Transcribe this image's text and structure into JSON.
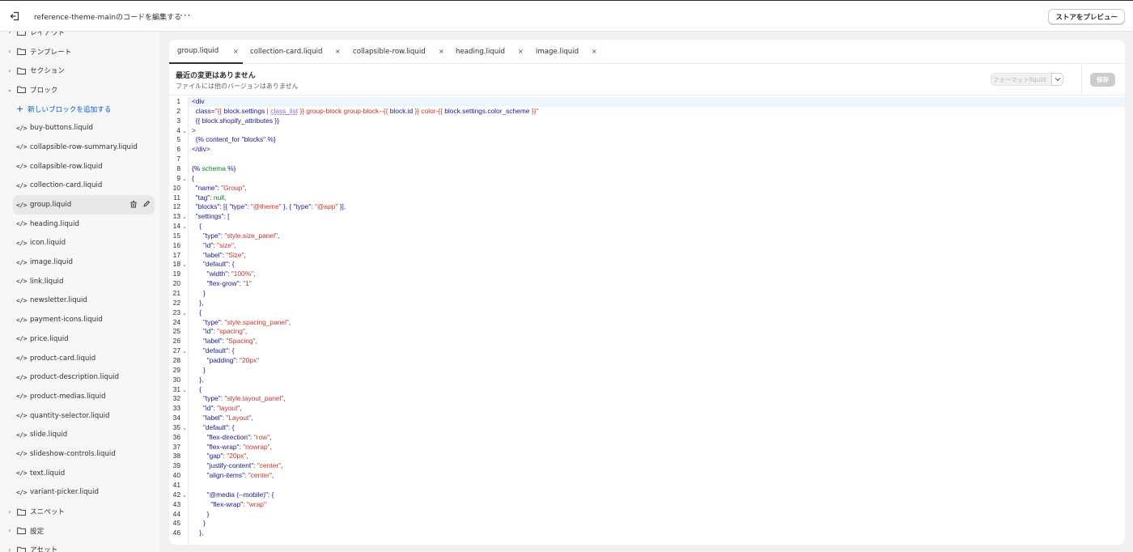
{
  "header": {
    "title": "reference-theme-mainのコードを編集する",
    "more": "···",
    "preview": "ストアをプレビュー"
  },
  "sidebar": {
    "folders_top": [
      {
        "label": "レイアウト"
      },
      {
        "label": "テンプレート"
      },
      {
        "label": "セクション"
      },
      {
        "label": "ブロック"
      }
    ],
    "add_block": "新しいブロックを追加する",
    "files": [
      "buy-buttons.liquid",
      "collapsible-row-summary.liquid",
      "collapsible-row.liquid",
      "collection-card.liquid",
      "group.liquid",
      "heading.liquid",
      "icon.liquid",
      "image.liquid",
      "link.liquid",
      "newsletter.liquid",
      "payment-icons.liquid",
      "price.liquid",
      "product-card.liquid",
      "product-description.liquid",
      "product-medias.liquid",
      "quantity-selector.liquid",
      "slide.liquid",
      "slideshow-controls.liquid",
      "text.liquid",
      "variant-picker.liquid"
    ],
    "active_file": "group.liquid",
    "folders_bottom": [
      {
        "label": "スニペット"
      },
      {
        "label": "設定"
      },
      {
        "label": "アセット"
      }
    ]
  },
  "tabs": [
    {
      "label": "group.liquid",
      "active": true
    },
    {
      "label": "collection-card.liquid"
    },
    {
      "label": "collapsible-row.liquid"
    },
    {
      "label": "heading.liquid"
    },
    {
      "label": "image.liquid"
    }
  ],
  "status": {
    "title": "最近の変更はありません",
    "subtitle": "ファイルには他のバージョンはありません",
    "format_button": "フォーマットliquid",
    "save_button": "保存"
  },
  "code": [
    {
      "n": "1",
      "fold": false,
      "parts": [
        [
          "t",
          "<div"
        ]
      ]
    },
    {
      "n": "2",
      "fold": false,
      "parts": [
        [
          "t",
          "  class="
        ],
        [
          "s",
          "\"{{ "
        ],
        [
          "k",
          "block.settings"
        ],
        [
          "s",
          " | "
        ],
        [
          "u",
          "class_list"
        ],
        [
          "s",
          " }} group-block group-block--{{ "
        ],
        [
          "k",
          "block.id"
        ],
        [
          "s",
          " }} color-{{ "
        ],
        [
          "k",
          "block.settings.color_scheme"
        ],
        [
          "s",
          " }}\""
        ]
      ]
    },
    {
      "n": "3",
      "fold": false,
      "parts": [
        [
          "k",
          "  {{ block.shopify_attributes }}"
        ]
      ]
    },
    {
      "n": "4",
      "fold": true,
      "parts": [
        [
          "t",
          ">"
        ]
      ]
    },
    {
      "n": "5",
      "fold": false,
      "parts": [
        [
          "k",
          "  {% content_for "
        ],
        [
          "t",
          "\"blocks\""
        ],
        [
          "k",
          " %}"
        ]
      ]
    },
    {
      "n": "6",
      "fold": false,
      "parts": [
        [
          "t",
          "</div>"
        ]
      ]
    },
    {
      "n": "7",
      "fold": false,
      "parts": []
    },
    {
      "n": "8",
      "fold": false,
      "parts": [
        [
          "k",
          "{% "
        ],
        [
          "g",
          "schema"
        ],
        [
          "k",
          " %}"
        ]
      ]
    },
    {
      "n": "9",
      "fold": true,
      "parts": [
        [
          "t",
          "{"
        ]
      ]
    },
    {
      "n": "10",
      "fold": false,
      "parts": [
        [
          "t",
          "  \"name\": "
        ],
        [
          "s",
          "\"Group\""
        ],
        [
          "t",
          ","
        ]
      ]
    },
    {
      "n": "11",
      "fold": false,
      "parts": [
        [
          "t",
          "  \"tag\": "
        ],
        [
          "g",
          "null"
        ],
        [
          "t",
          ","
        ]
      ]
    },
    {
      "n": "12",
      "fold": false,
      "parts": [
        [
          "t",
          "  \"blocks\": [{ \"type\": "
        ],
        [
          "s",
          "\"@theme\""
        ],
        [
          "t",
          " }, { \"type\": "
        ],
        [
          "s",
          "\"@app\""
        ],
        [
          "t",
          " }],"
        ]
      ]
    },
    {
      "n": "13",
      "fold": true,
      "parts": [
        [
          "t",
          "  \"settings\": ["
        ]
      ]
    },
    {
      "n": "14",
      "fold": true,
      "parts": [
        [
          "t",
          "    {"
        ]
      ]
    },
    {
      "n": "15",
      "fold": false,
      "parts": [
        [
          "t",
          "      \"type\": "
        ],
        [
          "s",
          "\"style.size_panel\""
        ],
        [
          "t",
          ","
        ]
      ]
    },
    {
      "n": "16",
      "fold": false,
      "parts": [
        [
          "t",
          "      \"id\": "
        ],
        [
          "s",
          "\"size\""
        ],
        [
          "t",
          ","
        ]
      ]
    },
    {
      "n": "17",
      "fold": false,
      "parts": [
        [
          "t",
          "      \"label\": "
        ],
        [
          "s",
          "\"Size\""
        ],
        [
          "t",
          ","
        ]
      ]
    },
    {
      "n": "18",
      "fold": true,
      "parts": [
        [
          "t",
          "      \"default\": {"
        ]
      ]
    },
    {
      "n": "19",
      "fold": false,
      "parts": [
        [
          "t",
          "        \"width\": "
        ],
        [
          "s",
          "\"100%\""
        ],
        [
          "t",
          ","
        ]
      ]
    },
    {
      "n": "20",
      "fold": false,
      "parts": [
        [
          "t",
          "        \"flex-grow\": "
        ],
        [
          "s",
          "\"1\""
        ]
      ]
    },
    {
      "n": "21",
      "fold": false,
      "parts": [
        [
          "t",
          "      }"
        ]
      ]
    },
    {
      "n": "22",
      "fold": false,
      "parts": [
        [
          "t",
          "    },"
        ]
      ]
    },
    {
      "n": "23",
      "fold": true,
      "parts": [
        [
          "t",
          "    {"
        ]
      ]
    },
    {
      "n": "24",
      "fold": false,
      "parts": [
        [
          "t",
          "      \"type\": "
        ],
        [
          "s",
          "\"style.spacing_panel\""
        ],
        [
          "t",
          ","
        ]
      ]
    },
    {
      "n": "25",
      "fold": false,
      "parts": [
        [
          "t",
          "      \"id\": "
        ],
        [
          "s",
          "\"spacing\""
        ],
        [
          "t",
          ","
        ]
      ]
    },
    {
      "n": "26",
      "fold": false,
      "parts": [
        [
          "t",
          "      \"label\": "
        ],
        [
          "s",
          "\"Spacing\""
        ],
        [
          "t",
          ","
        ]
      ]
    },
    {
      "n": "27",
      "fold": true,
      "parts": [
        [
          "t",
          "      \"default\": {"
        ]
      ]
    },
    {
      "n": "28",
      "fold": false,
      "parts": [
        [
          "t",
          "        \"padding\": "
        ],
        [
          "s",
          "\"20px\""
        ]
      ]
    },
    {
      "n": "29",
      "fold": false,
      "parts": [
        [
          "t",
          "      }"
        ]
      ]
    },
    {
      "n": "30",
      "fold": false,
      "parts": [
        [
          "t",
          "    },"
        ]
      ]
    },
    {
      "n": "31",
      "fold": true,
      "parts": [
        [
          "t",
          "    {"
        ]
      ]
    },
    {
      "n": "32",
      "fold": false,
      "parts": [
        [
          "t",
          "      \"type\": "
        ],
        [
          "s",
          "\"style.layout_panel\""
        ],
        [
          "t",
          ","
        ]
      ]
    },
    {
      "n": "33",
      "fold": false,
      "parts": [
        [
          "t",
          "      \"id\": "
        ],
        [
          "s",
          "\"layout\""
        ],
        [
          "t",
          ","
        ]
      ]
    },
    {
      "n": "34",
      "fold": false,
      "parts": [
        [
          "t",
          "      \"label\": "
        ],
        [
          "s",
          "\"Layout\""
        ],
        [
          "t",
          ","
        ]
      ]
    },
    {
      "n": "35",
      "fold": true,
      "parts": [
        [
          "t",
          "      \"default\": {"
        ]
      ]
    },
    {
      "n": "36",
      "fold": false,
      "parts": [
        [
          "t",
          "        \"flex-direction\": "
        ],
        [
          "s",
          "\"row\""
        ],
        [
          "t",
          ","
        ]
      ]
    },
    {
      "n": "37",
      "fold": false,
      "parts": [
        [
          "t",
          "        \"flex-wrap\": "
        ],
        [
          "s",
          "\"nowrap\""
        ],
        [
          "t",
          ","
        ]
      ]
    },
    {
      "n": "38",
      "fold": false,
      "parts": [
        [
          "t",
          "        \"gap\": "
        ],
        [
          "s",
          "\"20px\""
        ],
        [
          "t",
          ","
        ]
      ]
    },
    {
      "n": "39",
      "fold": false,
      "parts": [
        [
          "t",
          "        \"justify-content\": "
        ],
        [
          "s",
          "\"center\""
        ],
        [
          "t",
          ","
        ]
      ]
    },
    {
      "n": "40",
      "fold": false,
      "parts": [
        [
          "t",
          "        \"align-items\": "
        ],
        [
          "s",
          "\"center\""
        ],
        [
          "t",
          ","
        ]
      ]
    },
    {
      "n": "41",
      "fold": false,
      "parts": []
    },
    {
      "n": "42",
      "fold": true,
      "parts": [
        [
          "t",
          "        \"@media (--mobile)\": {"
        ]
      ]
    },
    {
      "n": "43",
      "fold": false,
      "parts": [
        [
          "t",
          "          \"flex-wrap\": "
        ],
        [
          "s",
          "\"wrap\""
        ]
      ]
    },
    {
      "n": "44",
      "fold": false,
      "parts": [
        [
          "t",
          "        }"
        ]
      ]
    },
    {
      "n": "45",
      "fold": false,
      "parts": [
        [
          "t",
          "      }"
        ]
      ]
    },
    {
      "n": "46",
      "fold": false,
      "parts": [
        [
          "t",
          "    },"
        ]
      ]
    }
  ]
}
